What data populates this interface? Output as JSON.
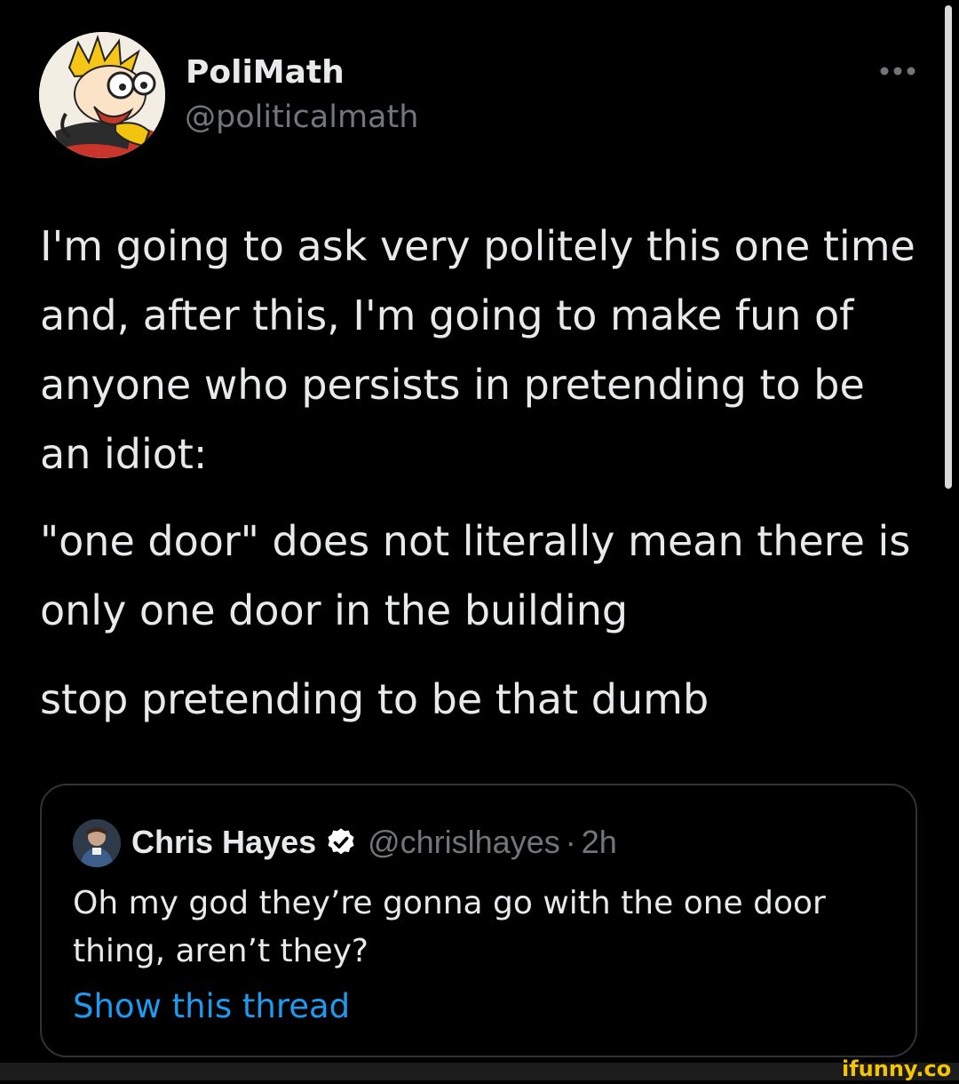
{
  "tweet": {
    "author_name": "PoliMath",
    "author_handle": "@politicalmath",
    "paragraphs": [
      "I'm going to ask very politely this one time and, after this, I'm going to make fun of anyone who persists in pretending to be an idiot:",
      "\"one door\" does not literally mean there is only one door in the building",
      "stop pretending to be that dumb"
    ]
  },
  "quoted_tweet": {
    "author_name": "Chris Hayes",
    "author_handle": "@chrislhayes",
    "separator": "·",
    "time": "2h",
    "text": "Oh my god they’re gonna go with the one door thing, aren’t they?",
    "show_thread_label": "Show this thread"
  },
  "watermark": {
    "text": "ifunny.co"
  },
  "colors": {
    "background": "#000000",
    "primary_text": "#e7e9ea",
    "secondary_text": "#71767b",
    "link": "#1d9bf0",
    "border": "#2f3336",
    "verified_badge": "#ffffff",
    "watermark": "#f5c400"
  },
  "icons": {
    "more": "more-horizontal-icon",
    "verified": "verified-badge-icon"
  }
}
